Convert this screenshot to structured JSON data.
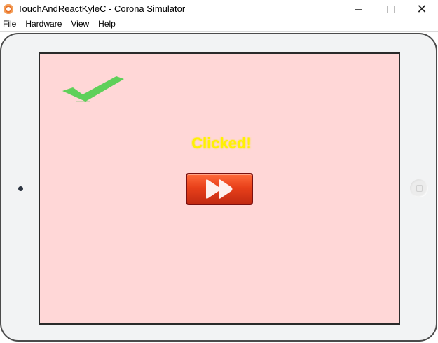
{
  "window": {
    "title": "TouchAndReactKyleC - Corona Simulator",
    "controls": {
      "minimize": "minimize",
      "maximize": "maximize",
      "close": "✕"
    }
  },
  "menu": {
    "items": [
      "File",
      "Hardware",
      "View",
      "Help"
    ]
  },
  "screen": {
    "background": "#ffd7d7",
    "status_text": "Clicked!",
    "status_color": "#fff200",
    "icons": {
      "checkmark": "checkmark-icon",
      "fast_forward": "fast-forward-icon"
    },
    "button_color": "#e8401a"
  }
}
